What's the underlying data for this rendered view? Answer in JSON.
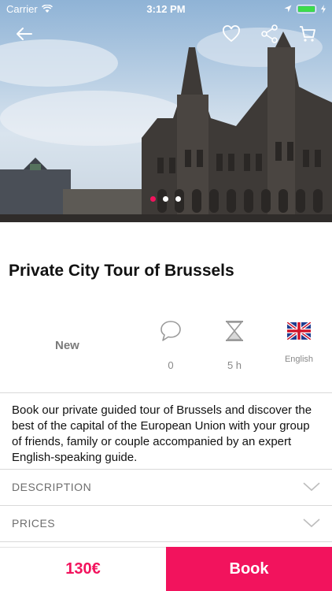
{
  "status_bar": {
    "carrier": "Carrier",
    "time": "3:12 PM"
  },
  "hero": {
    "image": "Brussels Grand Place building photo",
    "slides": 3,
    "active_slide": 1
  },
  "top_actions": [
    "back-arrow-icon",
    "heart-icon",
    "share-icon",
    "cart-icon"
  ],
  "tour": {
    "title": "Private City Tour of Brussels",
    "badge": "New",
    "reviews_count": "0",
    "duration": "5 h",
    "language": "English",
    "description": "Book our private guided tour of Brussels and discover the best of the capital of the European Union with your group of friends, family or couple accompanied by an expert English-speaking guide."
  },
  "sections": {
    "description": "DESCRIPTION",
    "prices": "PRICES"
  },
  "footer": {
    "price": "130€",
    "book": "Book"
  },
  "colors": {
    "accent": "#f2135d"
  }
}
